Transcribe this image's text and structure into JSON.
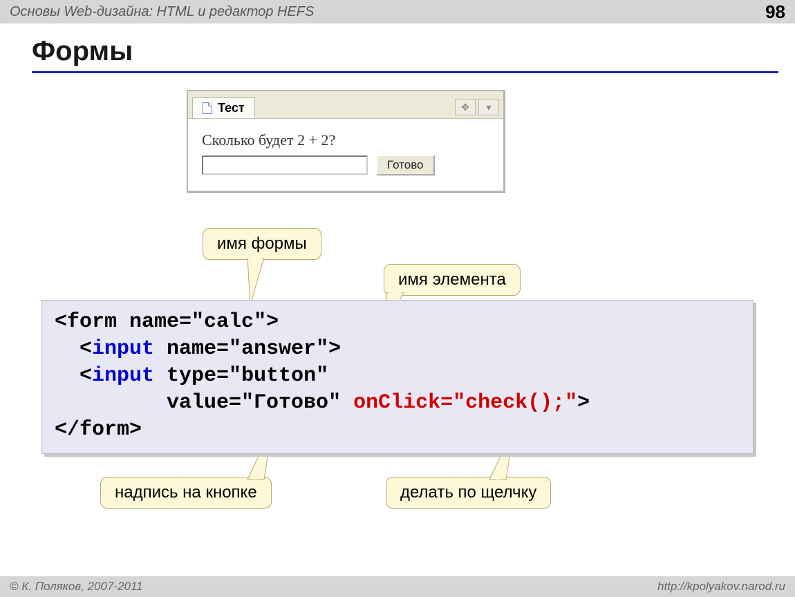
{
  "header": {
    "title": "Основы Web-дизайна: HTML и редактор HEFS",
    "page_number": "98"
  },
  "slide": {
    "title": "Формы"
  },
  "window": {
    "tab_label": "Тест",
    "question": "Сколько будет 2 + 2?",
    "button_label": "Готово"
  },
  "callouts": {
    "form_name": "имя формы",
    "element_name": "имя элемента",
    "button_caption": "надпись на кнопке",
    "onclick_action": "делать по щелчку"
  },
  "code": {
    "line1_a": "<form name=\"",
    "line1_b": "calc",
    "line1_c": "\">",
    "line2_a": "  <",
    "line2_tag": "input",
    "line2_b": " name=\"",
    "line2_c": "answer",
    "line2_d": "\">",
    "line3_a": "  <",
    "line3_tag": "input",
    "line3_b": " type=\"",
    "line3_c": "button",
    "line3_d": "\"",
    "line4_a": "         value=\"",
    "line4_b": "Готово",
    "line4_c": "\" ",
    "line4_onclick": "onClick=\"check();\"",
    "line4_d": ">",
    "line5": "</form>"
  },
  "footer": {
    "copyright": "© К. Поляков, 2007-2011",
    "url": "http://kpolyakov.narod.ru"
  }
}
